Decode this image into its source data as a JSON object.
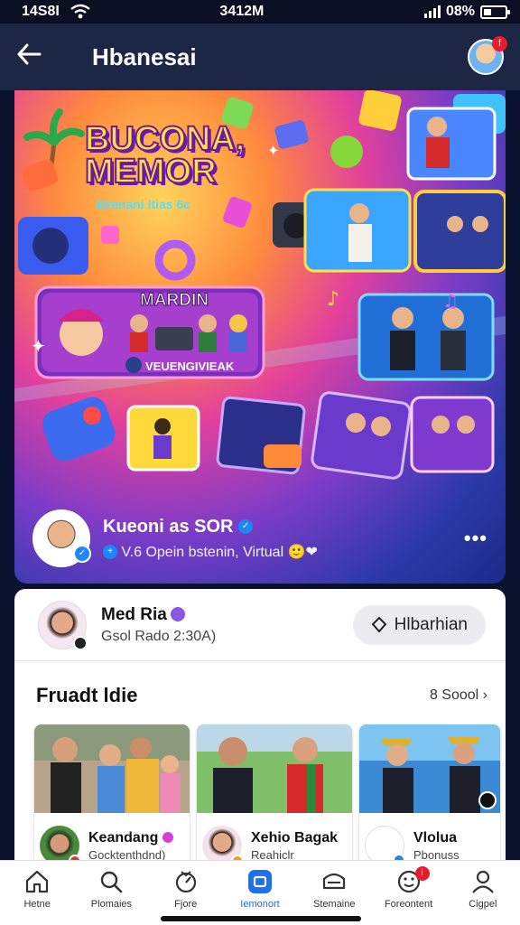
{
  "status_bar": {
    "time_left": "14S8I",
    "time_center": "3412M",
    "battery": "08%"
  },
  "header": {
    "title": "Hbanesai",
    "profile_badge": "f"
  },
  "hero": {
    "title_line1": "BUCONA,",
    "title_line2": "MEMOR",
    "subtitle": "Mrenani ltias 6c",
    "card_title": "MARDIN",
    "card_caption": "VEUENGIVIEAK",
    "channel_name": "Kueoni as SOR",
    "channel_subtitle": "V.6 Opein bstenin, Virtual",
    "more_label": "•••"
  },
  "host": {
    "name": "Med Ria",
    "meta": "Gsol Rado 2:30A)",
    "follow_label": "Hlbarhian"
  },
  "section": {
    "title": "Fruadt ldie",
    "link": "8 Soool ›"
  },
  "tiles": [
    {
      "name": "Keandang",
      "sub": "Gocktenthdnd)"
    },
    {
      "name": "Xehio Bagak",
      "sub": "Reahiclr"
    },
    {
      "name": "Vlolua",
      "sub": "Pbonuss"
    }
  ],
  "nav": [
    {
      "label": "Hetne",
      "icon": "home-icon"
    },
    {
      "label": "Plomaies",
      "icon": "search-icon"
    },
    {
      "label": "Fjore",
      "icon": "gauge-icon"
    },
    {
      "label": "Iemonort",
      "icon": "square-icon"
    },
    {
      "label": "Stemaine",
      "icon": "message-icon"
    },
    {
      "label": "Foreontent",
      "icon": "smile-icon",
      "badge": "i"
    },
    {
      "label": "Cigpel",
      "icon": "user-icon"
    }
  ],
  "colors": {
    "accent": "#1e6ef0",
    "header_bg": "#1c2645",
    "badge_red": "#e31d2c"
  }
}
